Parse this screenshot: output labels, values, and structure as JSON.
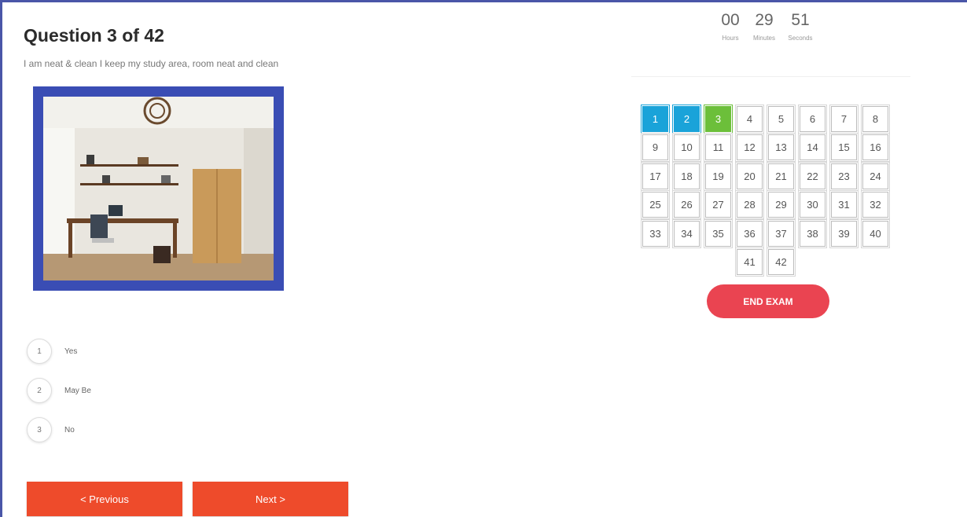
{
  "question": {
    "title": "Question 3 of 42",
    "text": "I am neat & clean I keep my study area, room neat and clean"
  },
  "image": {
    "icon": "room-photo"
  },
  "options": [
    {
      "num": "1",
      "label": "Yes"
    },
    {
      "num": "2",
      "label": "May Be"
    },
    {
      "num": "3",
      "label": "No"
    }
  ],
  "nav": {
    "prev_label": "< Previous",
    "next_label": "Next >"
  },
  "timer": {
    "hours": "00",
    "minutes": "29",
    "seconds": "51",
    "hours_label": "Hours",
    "minutes_label": "Minutes",
    "seconds_label": "Seconds"
  },
  "questions_grid": {
    "items": [
      "1",
      "2",
      "3",
      "4",
      "5",
      "6",
      "7",
      "8",
      "9",
      "10",
      "11",
      "12",
      "13",
      "14",
      "15",
      "16",
      "17",
      "18",
      "19",
      "20",
      "21",
      "22",
      "23",
      "24",
      "25",
      "26",
      "27",
      "28",
      "29",
      "30",
      "31",
      "32",
      "33",
      "34",
      "35",
      "36",
      "37",
      "38",
      "39",
      "40",
      "41",
      "42"
    ],
    "answered": [
      "1",
      "2"
    ],
    "current": "3"
  },
  "end_exam_label": "END EXAM",
  "colors": {
    "answered": "#1aa3d9",
    "current": "#6cbf3a",
    "nav_buttons": "#ee4b2b",
    "end_exam": "#ea4451",
    "photo_border": "#3a4db4"
  }
}
